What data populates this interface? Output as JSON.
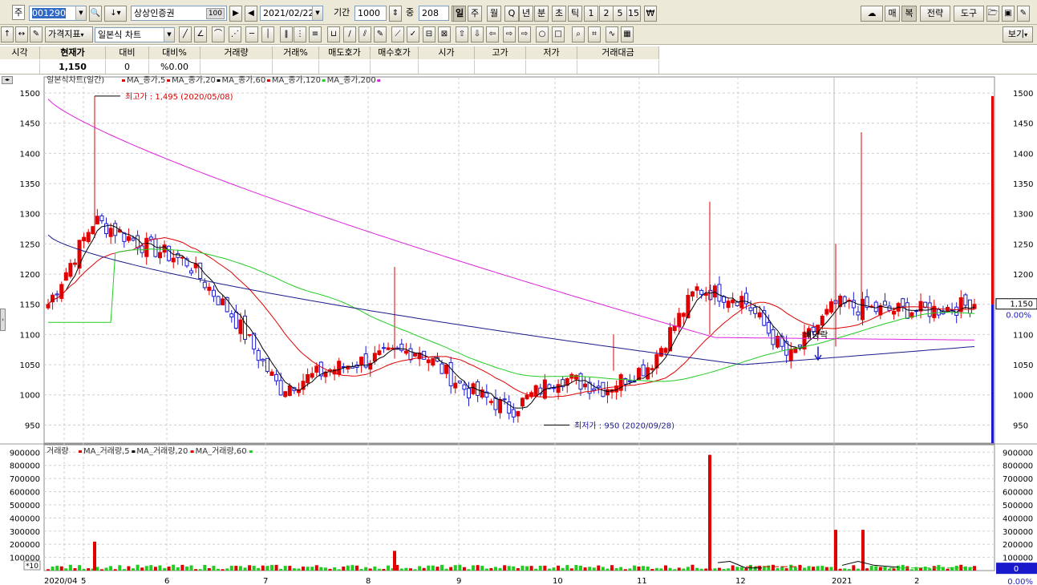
{
  "toolbar1": {
    "code_prefix": "주",
    "code_value": "001290",
    "stock_name": "상상인증권",
    "counter_badge": "100",
    "date_value": "2021/02/22",
    "period_label": "기간",
    "period_value": "1000",
    "count_label": "중",
    "count_value": "208",
    "period_buttons": [
      "일",
      "주",
      "월",
      "Q",
      "년",
      "분",
      "초",
      "틱",
      "1",
      "2",
      "5",
      "15",
      "₩"
    ],
    "right_buttons": [
      "매",
      "복",
      "전략",
      "도구"
    ]
  },
  "toolbar2": {
    "indicator_label": "가격지표",
    "chart_type_value": "일본식 차트",
    "view_label": "보기"
  },
  "quote": {
    "headers": [
      "시각",
      "현재가",
      "대비",
      "대비%",
      "거래량",
      "거래%",
      "매도호가",
      "매수호가",
      "시가",
      "고가",
      "저가",
      "거래대금"
    ],
    "values": [
      "",
      "1,150",
      "0",
      "%0.00",
      "",
      "",
      "",
      "",
      "",
      "",
      "",
      ""
    ]
  },
  "price_panel": {
    "legend_title": "일본식차트(일간)",
    "legend_items": [
      {
        "label": "MA_종가,5",
        "color": "#e00000"
      },
      {
        "label": "MA_종가,20",
        "color": "#000000"
      },
      {
        "label": "MA_종가,60",
        "color": "#e00000"
      },
      {
        "label": "MA_종가,120",
        "color": "#22cc22"
      },
      {
        "label": "MA_종가,200",
        "color": "#1a1a8c"
      }
    ],
    "legend_tail_color": "#dd22dd",
    "y_ticks": [
      "1500",
      "1450",
      "1400",
      "1350",
      "1300",
      "1250",
      "1200",
      "1150",
      "1100",
      "1050",
      "1000",
      "950"
    ],
    "high_annotation": "최고가 : 1,495 (2020/05/08)",
    "low_annotation": "최저가 : 950 (2020/09/28)",
    "dividend_label": "배당락",
    "current_price_tag": "1,150",
    "current_pct_tag": "0.00%"
  },
  "volume_panel": {
    "legend_title": "거래량",
    "legend_items": [
      {
        "label": "MA_거래량,5",
        "color": "#e00000"
      },
      {
        "label": "MA_거래량,20",
        "color": "#000000"
      },
      {
        "label": "MA_거래량,60",
        "color": "#e00000"
      }
    ],
    "legend_tail_color": "#22cc22",
    "y_ticks": [
      "900000",
      "800000",
      "700000",
      "600000",
      "500000",
      "400000",
      "300000",
      "200000",
      "100000"
    ],
    "unit_label": "*10",
    "current_volume_tag": "0",
    "current_pct_tag": "0.00%"
  },
  "x_axis": {
    "labels": [
      "2020/04",
      "5",
      "6",
      "7",
      "8",
      "9",
      "10",
      "11",
      "12",
      "2021",
      "2"
    ]
  },
  "chart_data": {
    "type": "candlestick",
    "price_range": [
      920,
      1520
    ],
    "volume_range": [
      0,
      920000
    ],
    "series_colors": {
      "up": "#e00000",
      "down": "#1a1acc",
      "ma5": "#e00000",
      "ma20": "#000000",
      "ma60": "#e00000",
      "ma120": "#22cc22",
      "ma200": "#1a1a8c"
    },
    "price_path": [
      {
        "d": "2020/04",
        "c": 1150
      },
      {
        "d": "2020/05/08",
        "c": 1290
      },
      {
        "d": "2020/05",
        "c": 1250
      },
      {
        "d": "2020/06",
        "c": 1220
      },
      {
        "d": "2020/06 end",
        "c": 1130
      },
      {
        "d": "2020/07",
        "c": 1010
      },
      {
        "d": "2020/07 mid",
        "c": 1040
      },
      {
        "d": "2020/08",
        "c": 1060
      },
      {
        "d": "2020/08 mid",
        "c": 1075
      },
      {
        "d": "2020/09",
        "c": 1010
      },
      {
        "d": "2020/09/28",
        "c": 975
      },
      {
        "d": "2020/10",
        "c": 1030
      },
      {
        "d": "2020/10 end",
        "c": 1010
      },
      {
        "d": "2020/11",
        "c": 1050
      },
      {
        "d": "2020/11 end",
        "c": 1175
      },
      {
        "d": "2020/12",
        "c": 1160
      },
      {
        "d": "2020/12 end",
        "c": 1060
      },
      {
        "d": "2021/01",
        "c": 1150
      },
      {
        "d": "2021/01 end",
        "c": 1140
      },
      {
        "d": "2021/02",
        "c": 1140
      },
      {
        "d": "2021/02/22",
        "c": 1150
      }
    ],
    "extremes": {
      "high": 1495,
      "high_date": "2020/05/08",
      "low": 950,
      "low_date": "2020/09/28"
    },
    "volume_spikes": [
      {
        "d": "2020/05/08",
        "v": 220000
      },
      {
        "d": "2020/08",
        "v": 150000
      },
      {
        "d": "2020/11 end",
        "v": 880000
      },
      {
        "d": "2021/01",
        "v": 310000
      },
      {
        "d": "2021/01 mid",
        "v": 310000
      }
    ]
  }
}
